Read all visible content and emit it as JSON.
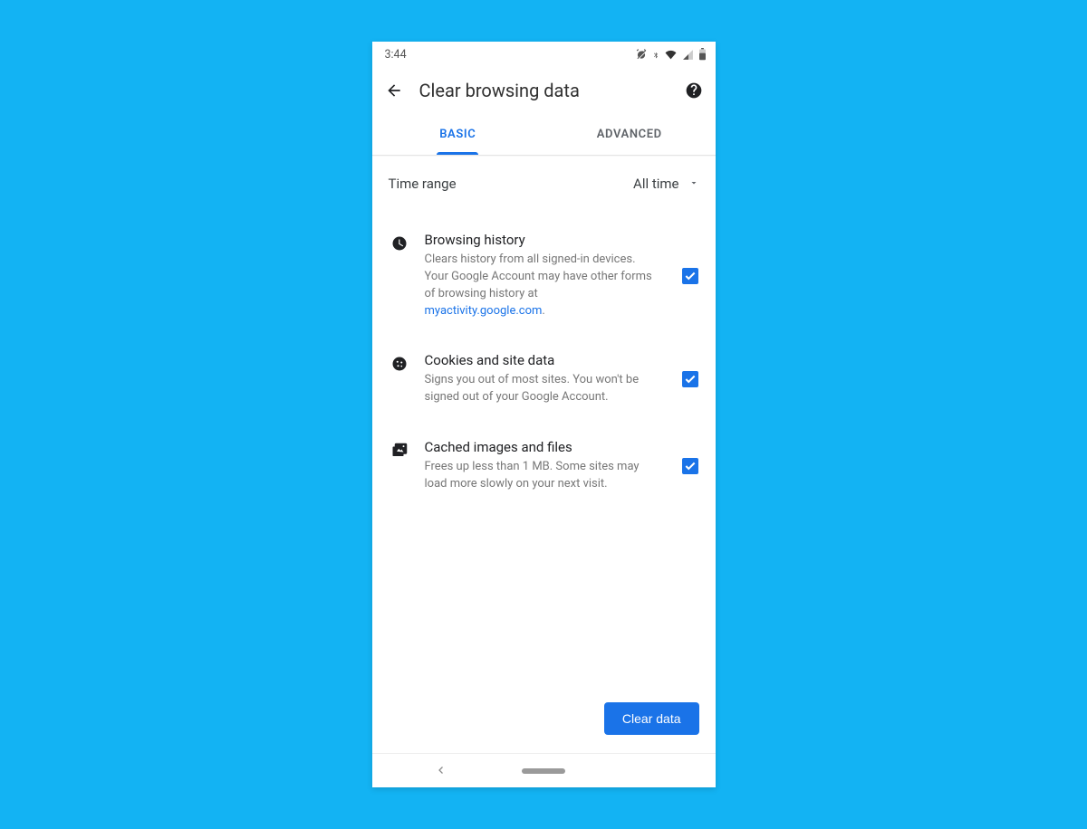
{
  "status_bar": {
    "time": "3:44"
  },
  "header": {
    "title": "Clear browsing data"
  },
  "tabs": {
    "basic": "BASIC",
    "advanced": "ADVANCED",
    "active": "basic"
  },
  "time_range": {
    "label": "Time range",
    "selected": "All time"
  },
  "options": [
    {
      "icon": "clock-icon",
      "title": "Browsing history",
      "description": "Clears history from all signed-in devices. Your Google Account may have other forms of browsing history at ",
      "link_text": "myactivity.google.com",
      "trailing": ".",
      "checked": true
    },
    {
      "icon": "cookie-icon",
      "title": "Cookies and site data",
      "description": "Signs you out of most sites. You won't be signed out of your Google Account.",
      "checked": true
    },
    {
      "icon": "image-stack-icon",
      "title": "Cached images and files",
      "description": "Frees up less than 1 MB. Some sites may load more slowly on your next visit.",
      "checked": true
    }
  ],
  "action": {
    "clear_label": "Clear data"
  },
  "colors": {
    "accent": "#1a73e8"
  }
}
